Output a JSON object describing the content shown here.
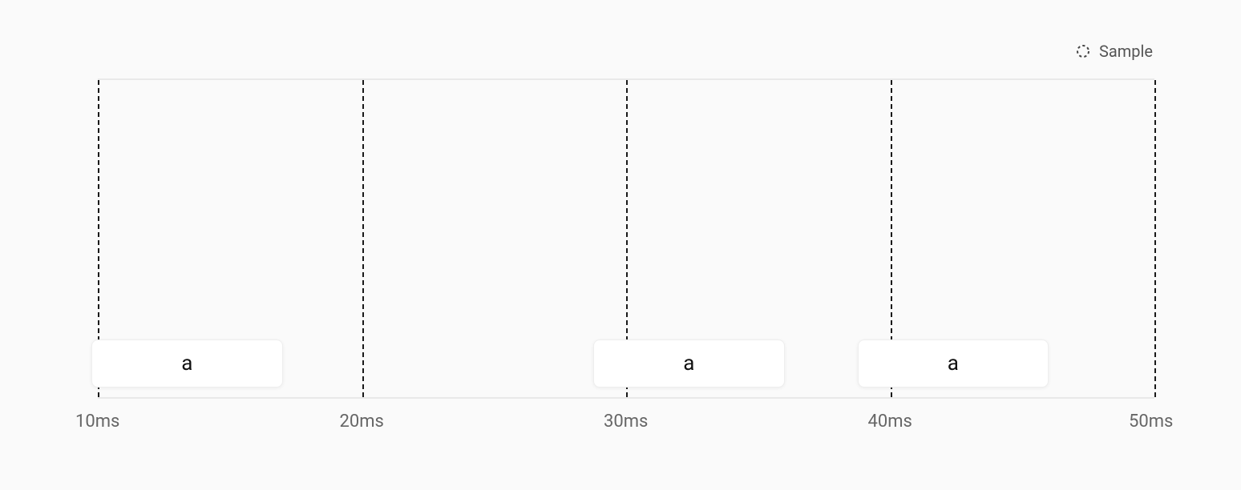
{
  "legend": {
    "label": "Sample",
    "icon": "dashed-circle-icon"
  },
  "axis": {
    "unit": "ms",
    "ticks": [
      {
        "value": 10,
        "label": "10ms"
      },
      {
        "value": 20,
        "label": "20ms"
      },
      {
        "value": 30,
        "label": "30ms"
      },
      {
        "value": 40,
        "label": "40ms"
      },
      {
        "value": 50,
        "label": "50ms"
      }
    ],
    "range": [
      10,
      50
    ]
  },
  "samples": [
    {
      "label": "a",
      "start_ms": 10,
      "end_ms": 17
    },
    {
      "label": "a",
      "start_ms": 29,
      "end_ms": 36
    },
    {
      "label": "a",
      "start_ms": 39,
      "end_ms": 46
    }
  ],
  "chart_data": {
    "type": "line",
    "title": "",
    "xlabel": "ms",
    "ylabel": "",
    "x_range": [
      10,
      50
    ],
    "x_ticks": [
      10,
      20,
      30,
      40,
      50
    ],
    "series": [
      {
        "name": "Sample",
        "events": [
          {
            "label": "a",
            "start": 10,
            "end": 17
          },
          {
            "label": "a",
            "start": 29,
            "end": 36
          },
          {
            "label": "a",
            "start": 39,
            "end": 46
          }
        ]
      }
    ]
  }
}
